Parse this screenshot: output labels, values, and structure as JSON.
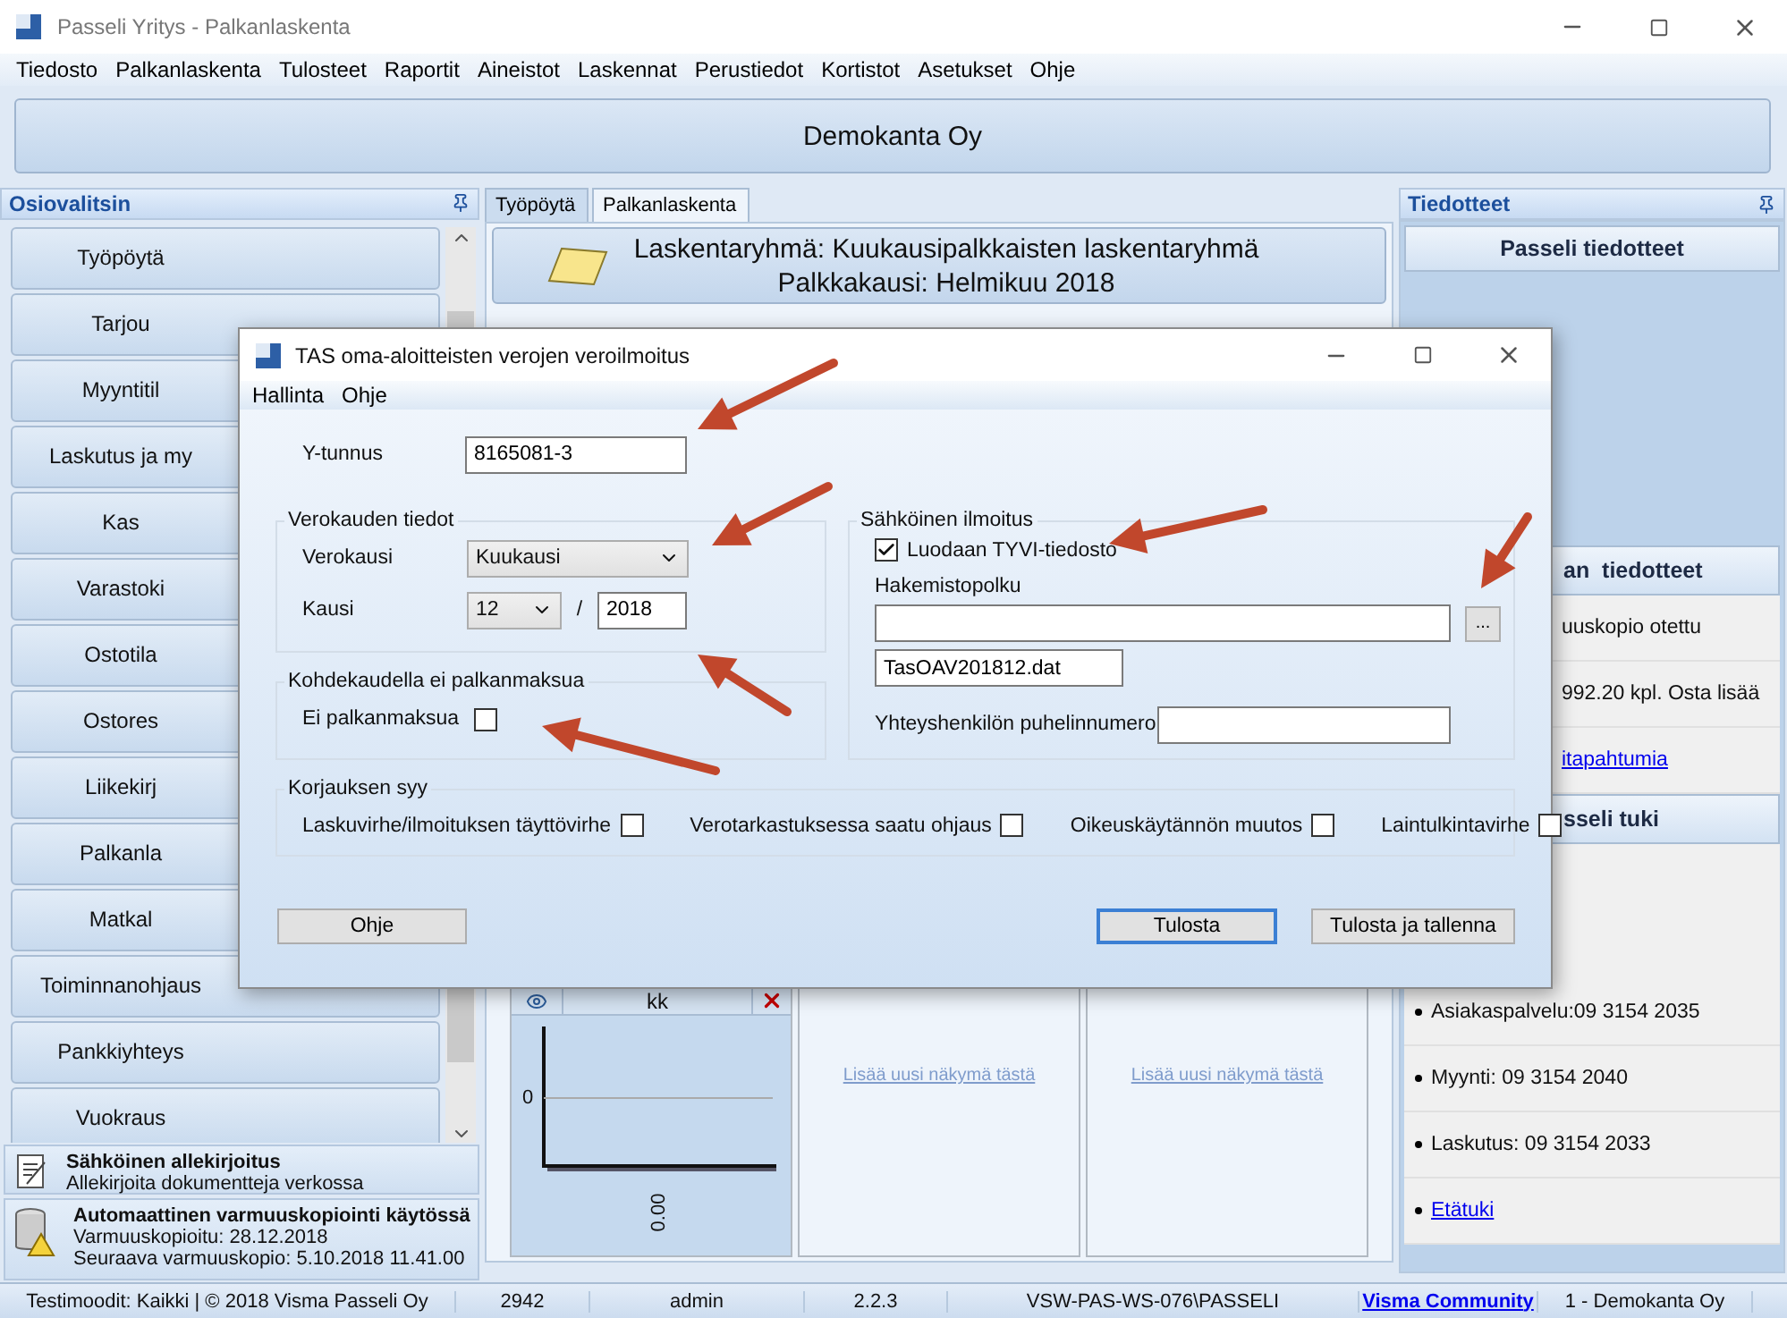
{
  "window": {
    "title": "Passeli Yritys - Palkanlaskenta"
  },
  "menu": [
    "Tiedosto",
    "Palkanlaskenta",
    "Tulosteet",
    "Raportit",
    "Aineistot",
    "Laskennat",
    "Perustiedot",
    "Kortistot",
    "Asetukset",
    "Ohje"
  ],
  "banner": "Demokanta Oy",
  "section_selector": {
    "title": "Osiovalitsin",
    "items": [
      "Työpöytä",
      "Tarjou",
      "Myyntitil",
      "Laskutus ja my",
      "Kas",
      "Varastoki",
      "Ostotila",
      "Ostores",
      "Liikekirj",
      "Palkanla",
      "Matkal",
      "Toiminnanohjaus",
      "Pankkiyhteys",
      "Vuokraus"
    ],
    "footer_items": [
      {
        "kind": "signature",
        "title": "Sähköinen allekirjoitus",
        "lines": [
          "Allekirjoita dokumentteja verkossa"
        ]
      },
      {
        "kind": "backup",
        "title": "Automaattinen varmuuskopiointi käytössä",
        "lines": [
          "Varmuuskopioitu: 28.12.2018",
          "Seuraava varmuuskopio: 5.10.2018 11.41.00"
        ]
      }
    ]
  },
  "center": {
    "tabs": [
      {
        "label": "Työpöytä",
        "selected": false
      },
      {
        "label": "Palkanlaskenta",
        "selected": true
      }
    ],
    "header_lines": [
      "Laskentaryhmä: Kuukausipalkkaisten laskentaryhmä",
      "Palkkakausi: Helmikuu 2018"
    ],
    "widgets": [
      {
        "kind": "chart",
        "title": "kk",
        "y_tick": "0",
        "x_label": "0.00"
      },
      {
        "kind": "placeholder",
        "link": "Lisää uusi näkymä tästä"
      },
      {
        "kind": "placeholder",
        "link": "Lisää uusi näkymä tästä"
      }
    ]
  },
  "notices": {
    "title": "Tiedotteet",
    "sections": [
      {
        "title": "Passeli tiedotteet"
      },
      {
        "title": "an  tiedotteet",
        "bulleted": false,
        "items": [
          {
            "kind": "text",
            "text": "uuskopio otettu"
          },
          {
            "kind": "text",
            "text": "992.20 kpl. Osta lisää"
          },
          {
            "kind": "link",
            "text": "itapahtumia"
          }
        ]
      },
      {
        "title": "sseli tuki",
        "bulleted": true,
        "items": [
          {
            "kind": "text",
            "text": "Asiakaspalvelu:09 3154 2035"
          },
          {
            "kind": "text",
            "text": "Myynti:  09 3154 2040"
          },
          {
            "kind": "text",
            "text": "Laskutus: 09 3154 2033"
          },
          {
            "kind": "link",
            "text": "Etätuki"
          }
        ]
      }
    ]
  },
  "dialog": {
    "title": "TAS oma-aloitteisten verojen veroilmoitus",
    "menu": [
      "Hallinta",
      "Ohje"
    ],
    "business_id": {
      "label": "Y-tunnus",
      "value": "8165081-3"
    },
    "tax_period": {
      "title": "Verokauden tiedot",
      "period_type": {
        "label": "Verokausi",
        "value": "Kuukausi"
      },
      "period": {
        "label": "Kausi",
        "month": "12",
        "separator": "/",
        "year": "2018"
      }
    },
    "no_payroll": {
      "title": "Kohdekaudella ei palkanmaksua",
      "label": "Ei palkanmaksua",
      "checked": false
    },
    "electronic": {
      "title": "Sähköinen ilmoitus",
      "create_file": {
        "label": "Luodaan TYVI-tiedosto",
        "checked": true
      },
      "directory": {
        "label": "Hakemistopolku",
        "browse": "..."
      },
      "file_name": "TasOAV201812.dat",
      "contact_phone": {
        "label": "Yhteyshenkilön puhelinnumero"
      }
    },
    "correction": {
      "title": "Korjauksen syy",
      "reasons": [
        {
          "label": "Laskuvirhe/ilmoituksen täyttövirhe",
          "checked": false
        },
        {
          "label": "Verotarkastuksessa saatu ohjaus",
          "checked": false
        },
        {
          "label": "Oikeuskäytännön muutos",
          "checked": false
        },
        {
          "label": "Laintulkintavirhe",
          "checked": false
        }
      ]
    },
    "help_button": "Ohje",
    "action_buttons": [
      {
        "label": "Tulosta",
        "focused": true
      },
      {
        "label": "Tulosta ja tallenna",
        "focused": false
      }
    ]
  },
  "status_bar": [
    {
      "kind": "text",
      "text": "Testimoodit: Kaikki | © 2018 Visma Passeli Oy"
    },
    {
      "kind": "text",
      "text": "2942"
    },
    {
      "kind": "text",
      "text": "admin"
    },
    {
      "kind": "text",
      "text": "2.2.3"
    },
    {
      "kind": "text",
      "text": "VSW-PAS-WS-076\\PASSELI"
    },
    {
      "kind": "link",
      "text": "Visma Community"
    },
    {
      "kind": "text",
      "text": "1 - Demokanta Oy"
    }
  ]
}
